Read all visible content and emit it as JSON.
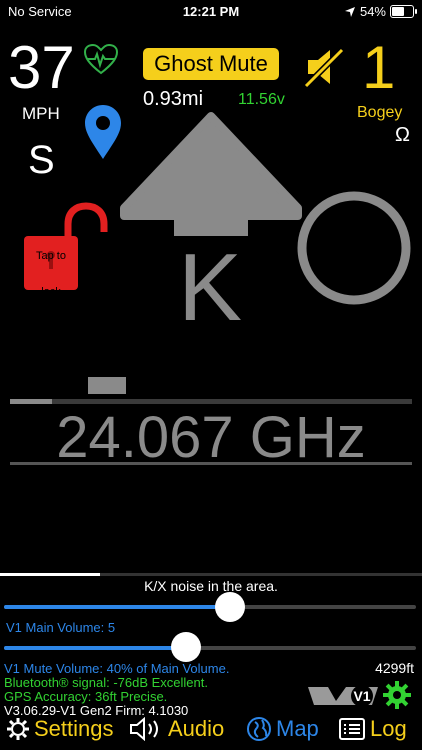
{
  "status": {
    "carrier": "No Service",
    "time": "12:21 PM",
    "battery": "54%",
    "battery_level": 0.54
  },
  "speed": {
    "value": "37",
    "unit": "MPH",
    "heading": "S"
  },
  "ghost_mute": "Ghost Mute",
  "distance": "0.93mi",
  "voltage": "11.56v",
  "bogey": {
    "count": "1",
    "label": "Bogey",
    "symbol": "Ω"
  },
  "lock": {
    "label": "Tap to lock"
  },
  "alert": {
    "band": "K",
    "frequency": "24.067 GHz"
  },
  "noise_text": "K/X noise in the area.",
  "main_volume": {
    "label": "V1 Main Volume: 5",
    "level": 0.55
  },
  "mute_volume": {
    "level": 0.44
  },
  "info": {
    "mute_volume": "V1 Mute Volume: 40% of Main Volume.",
    "bluetooth": "Bluetooth® signal: -76dB Excellent.",
    "gps": "GPS Accuracy: 36ft Precise.",
    "firmware": "V3.06.29-V1 Gen2 Firm: 4.1030",
    "altitude": "4299ft"
  },
  "logo_text": "V1",
  "tabs": {
    "settings": "Settings",
    "audio": "Audio",
    "map": "Map",
    "log": "Log"
  },
  "colors": {
    "yellow": "#f5cf1b",
    "blue": "#2d86e8",
    "green": "#32d232",
    "red": "#e22020",
    "gray": "#8a8a8a"
  }
}
